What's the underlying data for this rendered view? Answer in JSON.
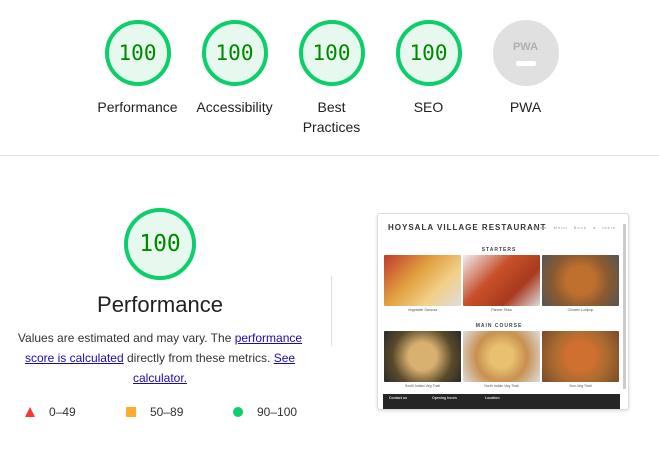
{
  "scores": [
    {
      "label": "Performance",
      "score": "100"
    },
    {
      "label": "Accessibility",
      "score": "100"
    },
    {
      "label": "Best Practices",
      "score": "100"
    },
    {
      "label": "SEO",
      "score": "100"
    },
    {
      "label": "PWA",
      "badge": "PWA"
    }
  ],
  "detail": {
    "score": "100",
    "title": "Performance",
    "desc_pre": "Values are estimated and may vary. The ",
    "link1": "performance score is calculated",
    "desc_mid": " directly from these metrics. ",
    "link2": "See calculator.",
    "legend": [
      {
        "range": "0–49",
        "color": "#ff3333",
        "icon": "triangle-icon"
      },
      {
        "range": "50–89",
        "color": "#ffaa33",
        "icon": "square-icon"
      },
      {
        "range": "90–100",
        "color": "#0cce6b",
        "icon": "circle-icon"
      }
    ]
  },
  "screenshot": {
    "site_title": "HOYSALA VILLAGE RESTAURANT",
    "nav": "Home Menu Book a table",
    "starters": "STARTERS",
    "main": "MAIN COURSE",
    "items": [
      "Vegetable Samosa",
      "Paneer Tikka",
      "Chicken Lollipop",
      "South Indian Veg Thali",
      "North Indian Veg Thali",
      "Non-Veg Thali"
    ],
    "footer": [
      "Contact us",
      "Opening hours",
      "Location"
    ]
  },
  "colors": {
    "pass": "#0cce6b",
    "pass_text": "#008800",
    "pass_bg": "#e7f9ee"
  }
}
